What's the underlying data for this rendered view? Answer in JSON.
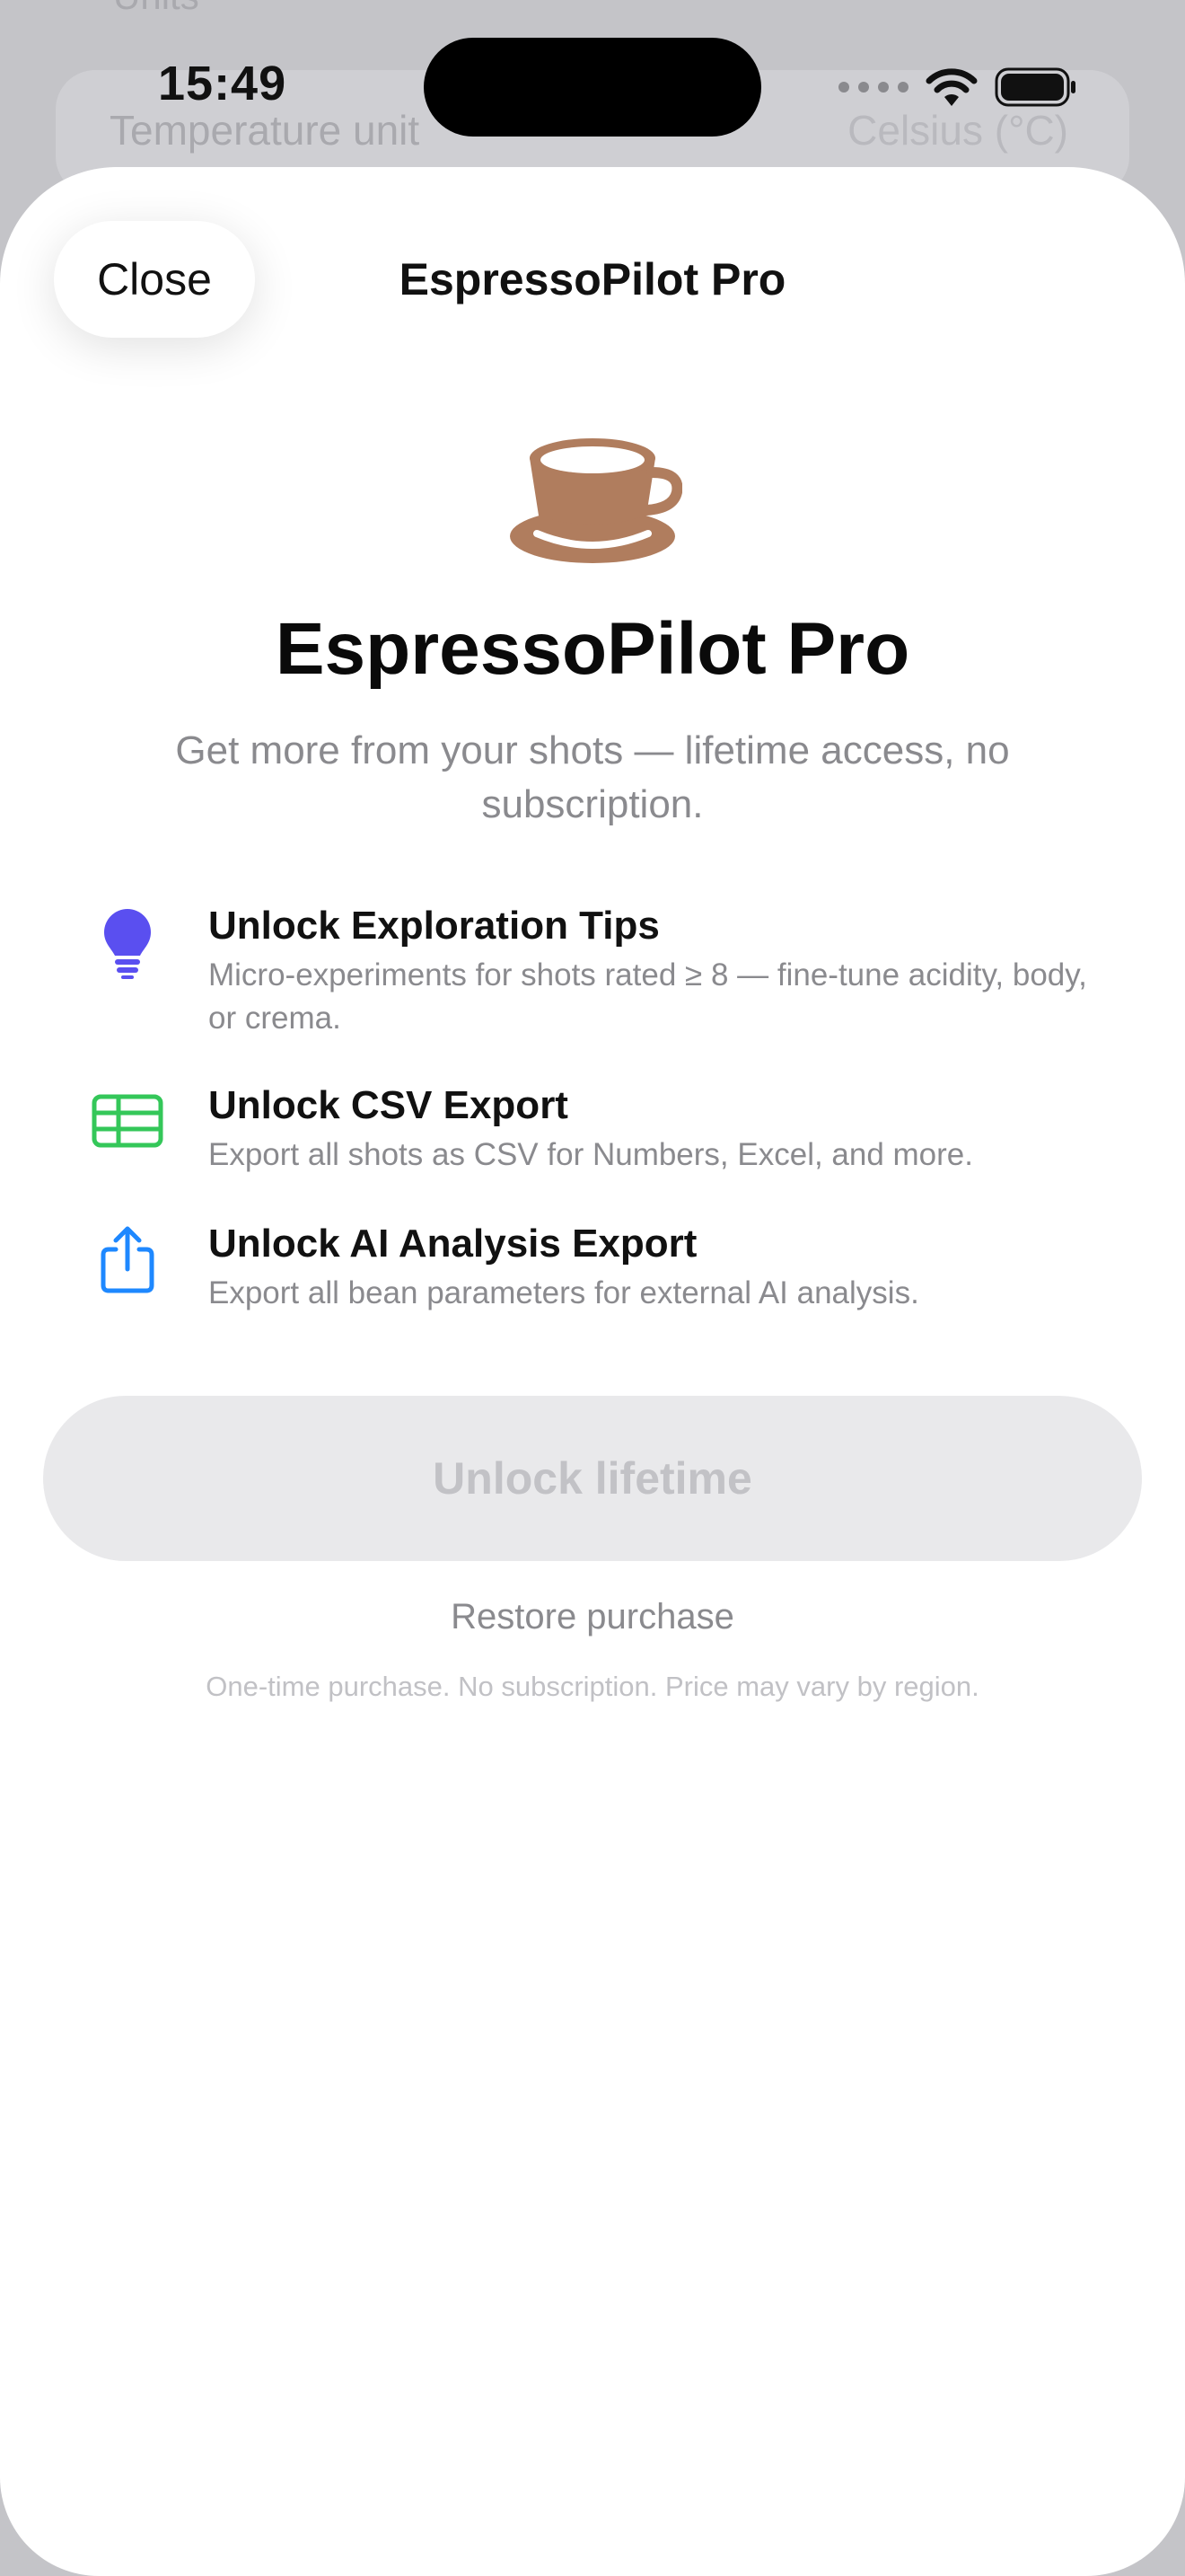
{
  "background": {
    "section_header": "Units",
    "row_label": "Temperature unit",
    "row_value": "Celsius (°C)"
  },
  "status_bar": {
    "time": "15:49"
  },
  "sheet": {
    "nav_title": "EspressoPilot Pro",
    "close_label": "Close",
    "hero_icon": "coffee-cup-icon",
    "title": "EspressoPilot Pro",
    "subtitle": "Get more from your shots — lifetime access, no subscription.",
    "features": [
      {
        "icon": "lightbulb-icon",
        "title": "Unlock Exploration Tips",
        "description": "Micro-experiments for shots rated ≥ 8 — fine-tune acidity, body, or crema."
      },
      {
        "icon": "table-icon",
        "title": "Unlock CSV Export",
        "description": "Export all shots as CSV for Numbers, Excel, and more."
      },
      {
        "icon": "share-icon",
        "title": "Unlock AI Analysis Export",
        "description": "Export all bean parameters for external AI analysis."
      }
    ],
    "unlock_label": "Unlock lifetime",
    "restore_label": "Restore purchase",
    "fineprint": "One-time purchase. No subscription. Price may vary by region."
  },
  "colors": {
    "coffee": "#b07d5e",
    "lightbulb": "#5a4ff0",
    "table": "#34c759",
    "share": "#1e88ff"
  }
}
